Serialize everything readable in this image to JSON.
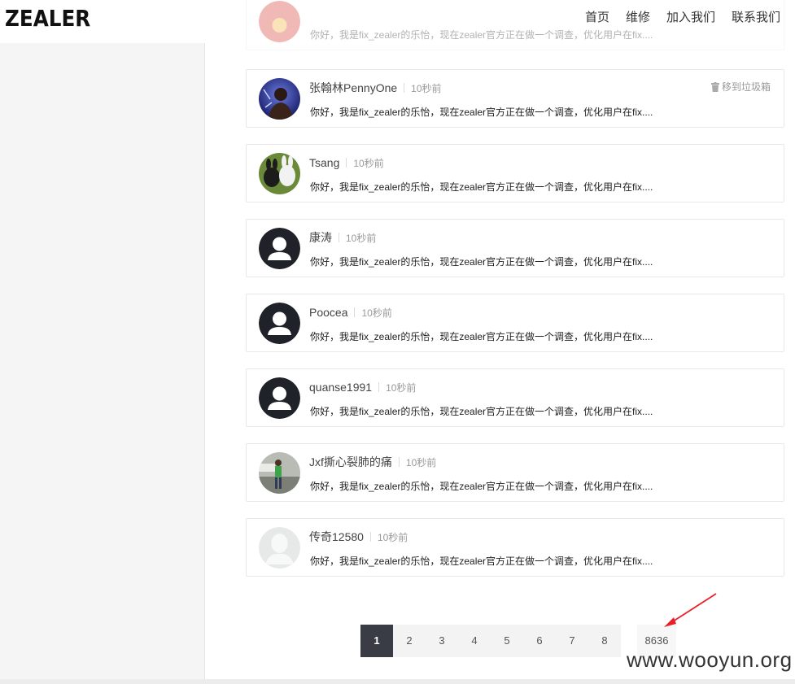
{
  "header": {
    "logo": "ZEALER",
    "nav": [
      "首页",
      "维修",
      "加入我们",
      "联系我们"
    ]
  },
  "comments": [
    {
      "name": "张翰林PennyOne",
      "time": "10秒前",
      "avatar_icon": "photo-avatar-icon",
      "trash_label": "移到垃圾箱",
      "text": "你好，我是fix_zealer的乐怡，现在zealer官方正在做一个调查，优化用户在fix...."
    },
    {
      "name": "Tsang",
      "time": "10秒前",
      "avatar_icon": "photo-avatar-icon",
      "text": "你好，我是fix_zealer的乐怡，现在zealer官方正在做一个调查，优化用户在fix...."
    },
    {
      "name": "康涛",
      "time": "10秒前",
      "avatar_icon": "default-user-icon",
      "text": "你好，我是fix_zealer的乐怡，现在zealer官方正在做一个调查，优化用户在fix...."
    },
    {
      "name": "Poocea",
      "time": "10秒前",
      "avatar_icon": "default-user-icon",
      "text": "你好，我是fix_zealer的乐怡，现在zealer官方正在做一个调查，优化用户在fix...."
    },
    {
      "name": "quanse1991",
      "time": "10秒前",
      "avatar_icon": "default-user-icon",
      "text": "你好，我是fix_zealer的乐怡，现在zealer官方正在做一个调查，优化用户在fix...."
    },
    {
      "name": "Jxf撕心裂肺的痛",
      "time": "10秒前",
      "avatar_icon": "photo-avatar-icon",
      "text": "你好，我是fix_zealer的乐怡，现在zealer官方正在做一个调查，优化用户在fix...."
    },
    {
      "name": "传奇12580",
      "time": "10秒前",
      "avatar_icon": "light-user-icon",
      "text": "你好，我是fix_zealer的乐怡，现在zealer官方正在做一个调查，优化用户在fix...."
    }
  ],
  "partial_comment": {
    "text": "你好，我是fix_zealer的乐怡，现在zealer官方正在做一个调查，优化用户在fix...."
  },
  "pagination": {
    "pages": [
      "1",
      "2",
      "3",
      "4",
      "5",
      "6",
      "7",
      "8"
    ],
    "last": "8636",
    "active": "1"
  },
  "watermark": "www.wooyun.org",
  "colors": {
    "active_page": "#393c44",
    "annotation_arrow": "#e8202a",
    "sidebar_bg": "#f5f5f5"
  }
}
